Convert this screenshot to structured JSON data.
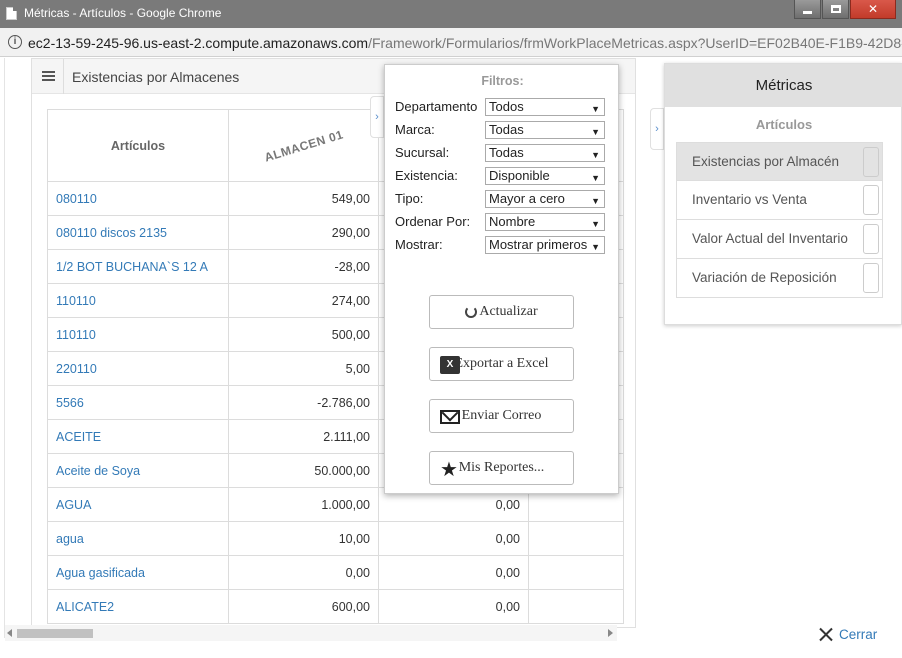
{
  "window": {
    "title": "Métricas - Artículos - Google Chrome",
    "url_host": "ec2-13-59-245-96.us-east-2.compute.amazonaws.com",
    "url_path": "/Framework/Formularios/frmWorkPlaceMetricas.aspx?UserID=EF02B40E-F1B9-42D8-...",
    "minimize": "",
    "maximize": "",
    "close": "✕"
  },
  "panel": {
    "title": "Existencias por Almacenes",
    "columns": [
      "Artículos",
      "ALMACEN 01",
      "",
      ""
    ],
    "rows": [
      {
        "articulo": "080110",
        "almacen01": "549,00",
        "c3": "",
        "c4": ""
      },
      {
        "articulo": "080110 discos 2135",
        "almacen01": "290,00",
        "c3": "",
        "c4": ""
      },
      {
        "articulo": "1/2 BOT BUCHANA`S 12 A",
        "almacen01": "-28,00",
        "c3": "",
        "c4": ""
      },
      {
        "articulo": "110110",
        "almacen01": "274,00",
        "c3": "",
        "c4": ""
      },
      {
        "articulo": "110110",
        "almacen01": "500,00",
        "c3": "",
        "c4": ""
      },
      {
        "articulo": "220110",
        "almacen01": "5,00",
        "c3": "",
        "c4": ""
      },
      {
        "articulo": "5566",
        "almacen01": "-2.786,00",
        "c3": "",
        "c4": ""
      },
      {
        "articulo": "ACEITE",
        "almacen01": "2.111,00",
        "c3": "",
        "c4": ""
      },
      {
        "articulo": "Aceite de Soya",
        "almacen01": "50.000,00",
        "c3": "",
        "c4": ""
      },
      {
        "articulo": "AGUA",
        "almacen01": "1.000,00",
        "c3": "0,00",
        "c4": ""
      },
      {
        "articulo": "agua",
        "almacen01": "10,00",
        "c3": "0,00",
        "c4": ""
      },
      {
        "articulo": "Agua gasificada",
        "almacen01": "0,00",
        "c3": "0,00",
        "c4": ""
      },
      {
        "articulo": "ALICATE2",
        "almacen01": "600,00",
        "c3": "0,00",
        "c4": ""
      }
    ]
  },
  "filters": {
    "title": "Filtros:",
    "fields": [
      {
        "label": "Departamento",
        "value": "Todos"
      },
      {
        "label": "Marca:",
        "value": "Todas"
      },
      {
        "label": "Sucursal:",
        "value": "Todas"
      },
      {
        "label": "Existencia:",
        "value": "Disponible"
      },
      {
        "label": "Tipo:",
        "value": "Mayor a cero"
      },
      {
        "label": "Ordenar Por:",
        "value": "Nombre"
      },
      {
        "label": "Mostrar:",
        "value": "Mostrar primeros"
      }
    ],
    "buttons": {
      "actualizar": "Actualizar",
      "exportar": "Exportar a Excel",
      "correo": "Enviar Correo",
      "reportes": "Mis Reportes..."
    }
  },
  "metrics": {
    "title": "Métricas",
    "subtitle": "Artículos",
    "items": [
      "Existencias por Almacén",
      "Inventario vs Venta",
      "Valor Actual del Inventario",
      "Variación de Reposición"
    ]
  },
  "footer": {
    "cerrar": "Cerrar"
  }
}
